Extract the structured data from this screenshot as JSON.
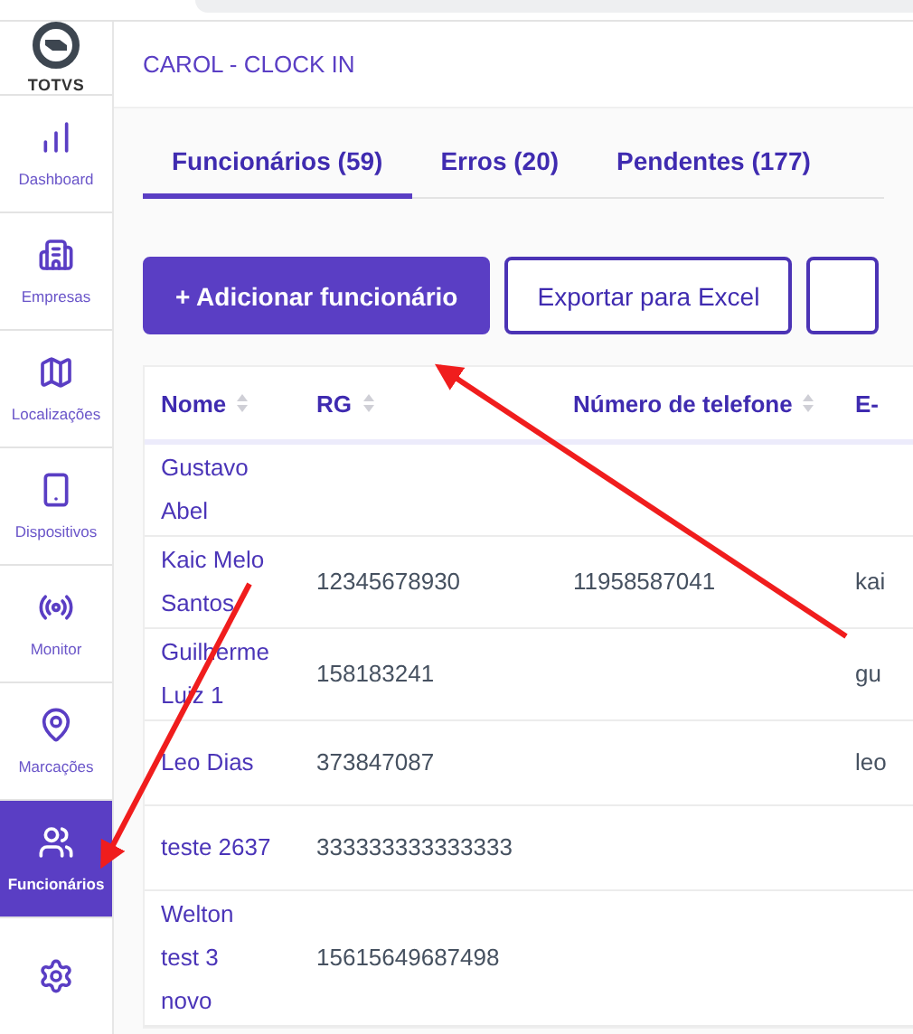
{
  "sidebar": {
    "logo_label": "TOTVS",
    "items": [
      {
        "label": "Dashboard",
        "selected": false
      },
      {
        "label": "Empresas",
        "selected": false
      },
      {
        "label": "Localizações",
        "selected": false
      },
      {
        "label": "Dispositivos",
        "selected": false
      },
      {
        "label": "Monitor",
        "selected": false
      },
      {
        "label": "Marcações",
        "selected": false
      },
      {
        "label": "Funcionários",
        "selected": true
      },
      {
        "selected": false
      }
    ]
  },
  "header": {
    "title": "CAROL - CLOCK IN"
  },
  "tabs": [
    {
      "label": "Funcionários (59)",
      "selected": true
    },
    {
      "label": "Erros (20)",
      "selected": false
    },
    {
      "label": "Pendentes (177)",
      "selected": false
    }
  ],
  "actions": [
    {
      "label": "+ Adicionar funcionário",
      "kind": "primary"
    },
    {
      "label": "Exportar para Excel",
      "kind": "outline"
    },
    {
      "kind": "outline"
    }
  ],
  "table": {
    "columns": [
      {
        "label": "Nome",
        "sortable": true
      },
      {
        "label": "RG",
        "sortable": true
      },
      {
        "label": "Número de telefone",
        "sortable": true
      },
      {
        "label": "E-",
        "sortable": false
      }
    ],
    "rows": [
      {
        "name": "Gustavo Abel"
      },
      {
        "name": "Kaic Melo Santos",
        "rg": "12345678930",
        "phone": "11958587041",
        "email": "kai"
      },
      {
        "name": "Guilherme Luiz 1",
        "rg": "158183241",
        "email": "gu"
      },
      {
        "name": "Leo Dias",
        "rg": "373847087",
        "email": "leo"
      },
      {
        "name": "teste 2637",
        "rg": "333333333333333"
      },
      {
        "name": "Welton test 3 novo",
        "rg": "15615649687498"
      }
    ]
  },
  "annotations": [
    {
      "kind": "arrow"
    },
    {
      "kind": "arrow"
    }
  ]
}
